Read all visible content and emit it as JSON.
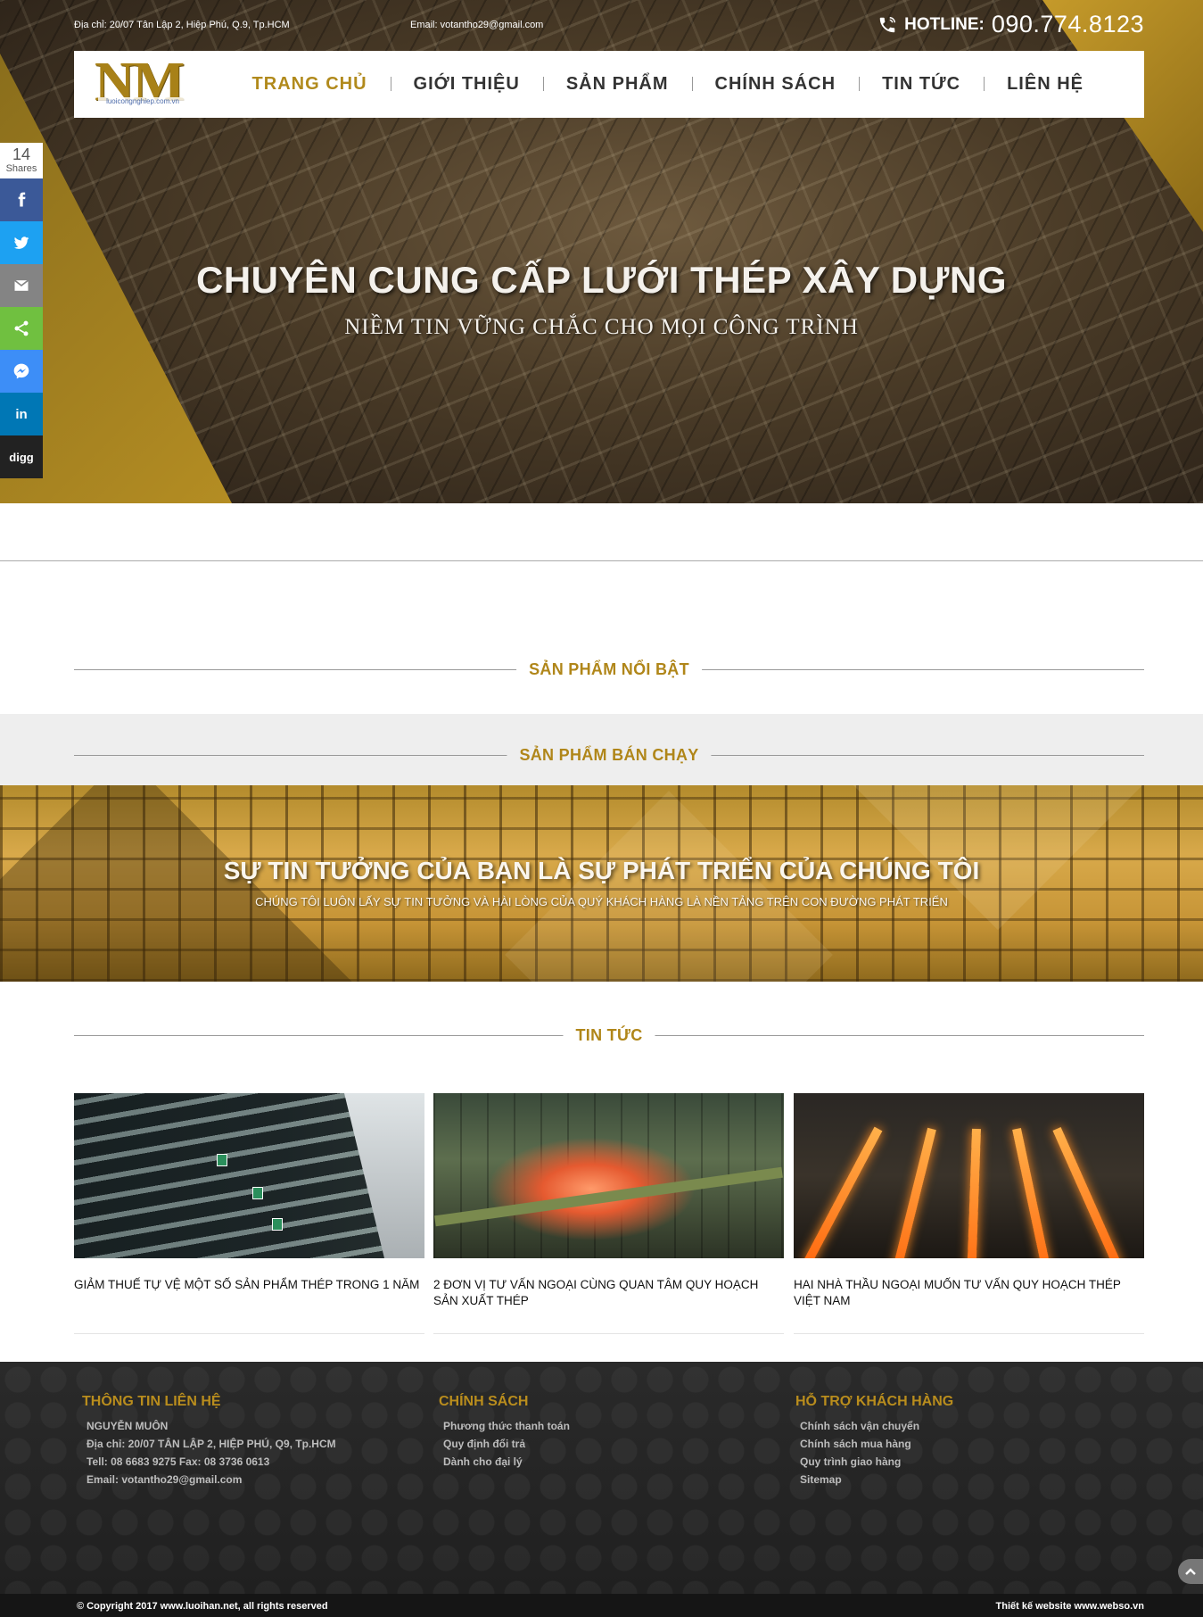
{
  "topbar": {
    "address": "Địa chỉ: 20/07 Tân Lập 2, Hiệp Phú,  Q.9, Tp.HCM",
    "email": "Email: votantho29@gmail.com",
    "hotline_label": "HOTLINE:",
    "hotline_number": "090.774.8123"
  },
  "logo": {
    "mark": "NM",
    "subtext": "luoicongnghiep.com.vn"
  },
  "nav": {
    "items": [
      {
        "label": "TRANG CHỦ"
      },
      {
        "label": "GIỚI THIỆU"
      },
      {
        "label": "SẢN PHẨM"
      },
      {
        "label": "CHÍNH SÁCH"
      },
      {
        "label": "TIN TỨC"
      },
      {
        "label": "LIÊN HỆ"
      }
    ],
    "active": "TRANG CHỦ"
  },
  "hero": {
    "title": "CHUYÊN CUNG CẤP LƯỚI THÉP XÂY DỰNG",
    "subtitle": "NIỀM TIN VỮNG CHẮC CHO MỌI CÔNG TRÌNH"
  },
  "share": {
    "count": "14",
    "count_label": "Shares",
    "buttons": [
      {
        "icon": "facebook-icon",
        "color": "#3b5998"
      },
      {
        "icon": "twitter-icon",
        "color": "#1da1f2"
      },
      {
        "icon": "email-icon",
        "color": "#848484"
      },
      {
        "icon": "share-icon",
        "color": "#70c040"
      },
      {
        "icon": "messenger-icon",
        "color": "#3d8ef7"
      },
      {
        "icon": "linkedin-icon",
        "color": "#0077b5",
        "text": "in"
      },
      {
        "icon": "digg-icon",
        "color": "#222222",
        "text": "digg"
      }
    ]
  },
  "sections": {
    "featured": "SẢN PHẨM NỔI BẬT",
    "bestseller": "SẢN PHẨM BÁN CHẠY",
    "news": "TIN TỨC"
  },
  "trust": {
    "title": "SỰ TIN TƯỞNG CỦA BẠN LÀ SỰ PHÁT TRIỂN CỦA CHÚNG TÔI",
    "subtitle": "CHÚNG TÔI LUÔN LẤY SỰ TIN TƯỞNG VÀ HÀI LÒNG CỦA QUÝ KHÁCH HÀNG LÀ NỀN TẢNG TRÊN CON ĐƯỜNG PHÁT TRIỂN"
  },
  "news": [
    {
      "title": "GIẢM THUẾ TỰ VỆ MỘT SỐ SẢN PHẨM THÉP TRONG 1 NĂM"
    },
    {
      "title": "2 ĐƠN VỊ TƯ VẤN NGOẠI CÙNG QUAN TÂM QUY HOẠCH SẢN XUẤT THÉP"
    },
    {
      "title": "HAI NHÀ THẦU NGOẠI MUỐN TƯ VẤN QUY HOẠCH THÉP VIỆT NAM"
    }
  ],
  "footer": {
    "contact": {
      "heading": "THÔNG TIN LIÊN HỆ",
      "items": [
        "NGUYỄN MUÔN",
        "Địa chỉ: 20/07 TÂN LẬP 2, HIỆP PHÚ,  Q9, Tp.HCM",
        "Tell: 08 6683 9275   Fax: 08 3736 0613",
        "Email: votantho29@gmail.com"
      ]
    },
    "policy": {
      "heading": "CHÍNH SÁCH",
      "items": [
        "Phương thức thanh toán",
        "Quy định đổi trả",
        "Dành cho đại lý"
      ]
    },
    "support": {
      "heading": "HỖ TRỢ KHÁCH HÀNG",
      "items": [
        "Chính sách vận chuyển",
        "Chính sách mua hàng",
        "Quy trình giao hàng",
        "Sitemap"
      ]
    },
    "copyright": "© Copyright 2017 www.luoihan.net, all rights reserved",
    "designer": "Thiết kế website www.webso.vn"
  },
  "colors": {
    "gold": "#b08619",
    "dark": "#1f1f1f",
    "nav_text": "#333333"
  }
}
